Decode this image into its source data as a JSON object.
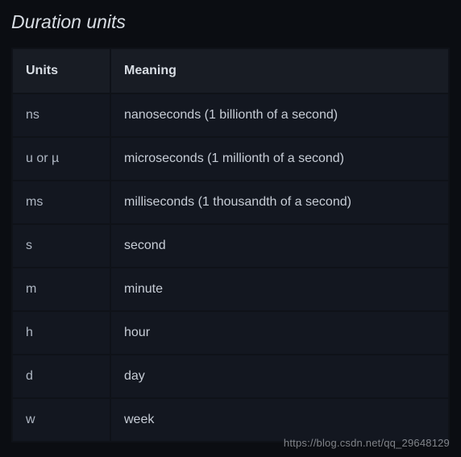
{
  "title": "Duration units",
  "columns": {
    "units": "Units",
    "meaning": "Meaning"
  },
  "rows": [
    {
      "units": "ns",
      "meaning": "nanoseconds (1 billionth of a second)"
    },
    {
      "units": "u or µ",
      "meaning": "microseconds (1 millionth of a second)"
    },
    {
      "units": "ms",
      "meaning": "milliseconds (1 thousandth of a second)"
    },
    {
      "units": "s",
      "meaning": "second"
    },
    {
      "units": "m",
      "meaning": "minute"
    },
    {
      "units": "h",
      "meaning": "hour"
    },
    {
      "units": "d",
      "meaning": "day"
    },
    {
      "units": "w",
      "meaning": "week"
    }
  ],
  "watermark": "https://blog.csdn.net/qq_29648129"
}
